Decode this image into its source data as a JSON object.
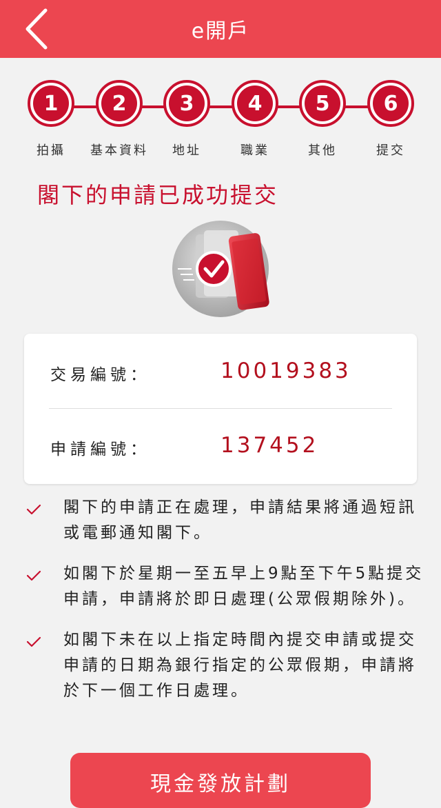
{
  "header": {
    "title": "e開戶",
    "back_icon": "chevron-left-icon"
  },
  "steps": [
    {
      "number": "1",
      "label": "拍攝"
    },
    {
      "number": "2",
      "label": "基本資料"
    },
    {
      "number": "3",
      "label": "地址"
    },
    {
      "number": "4",
      "label": "職業"
    },
    {
      "number": "5",
      "label": "其他"
    },
    {
      "number": "6",
      "label": "提交"
    }
  ],
  "success": {
    "title": "閣下的申請已成功提交",
    "illustration_icon": "phone-check-icon"
  },
  "card": {
    "transaction": {
      "label": "交易編號：",
      "value": "10019383"
    },
    "application": {
      "label": "申請編號：",
      "value": "137452"
    }
  },
  "notes": [
    {
      "text": "閣下的申請正在處理，申請結果將通過短訊或電郵通知閣下。"
    },
    {
      "text": "如閣下於星期一至五早上9點至下午5點提交申請，申請將於即日處理(公眾假期除外)。"
    },
    {
      "text": "如閣下未在以上指定時間內提交申請或提交申請的日期為銀行指定的公眾假期，申請將於下一個工作日處理。"
    }
  ],
  "cta": {
    "label": "現金發放計劃"
  },
  "colors": {
    "header": "#ec4650",
    "accent": "#c8102e",
    "background": "#f2f2f2"
  }
}
